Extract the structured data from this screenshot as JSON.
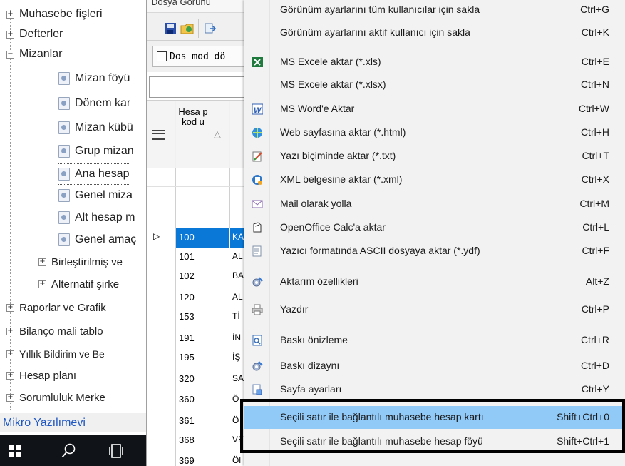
{
  "tree": {
    "items": [
      {
        "label": "Muhasebe fişleri",
        "expander": "+"
      },
      {
        "label": "Defterler",
        "expander": "+"
      },
      {
        "label": "Mizanlar",
        "expander": "−"
      },
      {
        "label": "Mizan föyü"
      },
      {
        "label": "Dönem kar"
      },
      {
        "label": "Mizan kübü"
      },
      {
        "label": "Grup mizan"
      },
      {
        "label": "Ana hesap"
      },
      {
        "label": "Genel miza"
      },
      {
        "label": "Alt hesap m"
      },
      {
        "label": "Genel amaç"
      },
      {
        "label": "Birleştirilmiş ve",
        "expander": "+"
      },
      {
        "label": "Alternatif şirke",
        "expander": "+"
      },
      {
        "label": "Raporlar ve Grafik",
        "expander": "+"
      },
      {
        "label": "Bilanço mali tablo",
        "expander": "+"
      },
      {
        "label": "Yıllık Bildirim ve Be",
        "expander": "+"
      },
      {
        "label": "Hesap planı",
        "expander": "+"
      },
      {
        "label": "Sorumluluk Merke",
        "expander": "+"
      }
    ],
    "footer_link": "Mikro Yazılımevi"
  },
  "grid": {
    "menubar": "Dosya  Görünü",
    "checkbox_label": "Dos mod dö",
    "column_header": "Hesa p kod u",
    "sort_glyph": "△",
    "current_row_marker": "▷",
    "rows": [
      {
        "code": "100",
        "name": "KA"
      },
      {
        "code": "101",
        "name": "AL"
      },
      {
        "code": "102",
        "name": "BA"
      },
      {
        "code": "120",
        "name": "AL"
      },
      {
        "code": "153",
        "name": "Tİ"
      },
      {
        "code": "191",
        "name": "İN"
      },
      {
        "code": "195",
        "name": "İŞ"
      },
      {
        "code": "320",
        "name": "SA"
      },
      {
        "code": "360",
        "name": "Ö"
      },
      {
        "code": "361",
        "name": "Ö"
      },
      {
        "code": "368",
        "name": "VE"
      },
      {
        "code": "369",
        "name": "Öl"
      }
    ]
  },
  "menu": {
    "items": [
      {
        "label": "Görünüm ayarlarını tüm kullanıcılar için sakla",
        "shortcut": "Ctrl+G",
        "icon": ""
      },
      {
        "label": "Görünüm ayarlarını aktif kullanıcı için sakla",
        "shortcut": "Ctrl+K",
        "icon": ""
      },
      {
        "label": "MS Excele aktar (*.xls)",
        "shortcut": "Ctrl+E",
        "icon": "excel-icon"
      },
      {
        "label": "MS Excele aktar (*.xlsx)",
        "shortcut": "Ctrl+N",
        "icon": ""
      },
      {
        "label": "MS Word'e Aktar",
        "shortcut": "Ctrl+W",
        "icon": "word-icon"
      },
      {
        "label": "Web sayfasına aktar (*.html)",
        "shortcut": "Ctrl+H",
        "icon": "web-icon"
      },
      {
        "label": "Yazı biçiminde aktar (*.txt)",
        "shortcut": "Ctrl+T",
        "icon": "text-edit-icon"
      },
      {
        "label": "XML belgesine aktar (*.xml)",
        "shortcut": "Ctrl+X",
        "icon": "xml-icon"
      },
      {
        "label": "Mail olarak yolla",
        "shortcut": "Ctrl+M",
        "icon": "mail-icon"
      },
      {
        "label": "OpenOffice Calc'a aktar",
        "shortcut": "Ctrl+L",
        "icon": "openoffice-icon"
      },
      {
        "label": "Yazıcı formatında ASCII dosyaya aktar (*.ydf)",
        "shortcut": "Ctrl+F",
        "icon": "ascii-file-icon"
      },
      {
        "label": "Aktarım özellikleri",
        "shortcut": "Alt+Z",
        "icon": "settings-gear-icon"
      },
      {
        "label": "Yazdır",
        "shortcut": "Ctrl+P",
        "icon": "printer-icon"
      },
      {
        "label": "Baskı önizleme",
        "shortcut": "Ctrl+R",
        "icon": "print-preview-icon"
      },
      {
        "label": "Baskı dizaynı",
        "shortcut": "Ctrl+D",
        "icon": "print-design-icon"
      },
      {
        "label": "Sayfa ayarları",
        "shortcut": "Ctrl+Y",
        "icon": "page-setup-icon"
      },
      {
        "label": "Seçili satır ile bağlantılı muhasebe hesap kartı",
        "shortcut": "Shift+Ctrl+0",
        "icon": ""
      },
      {
        "label": "Seçili satır ile bağlantılı muhasebe hesap föyü",
        "shortcut": "Shift+Ctrl+1",
        "icon": ""
      }
    ],
    "highlighted_index": 16,
    "colors": {
      "highlight": "#91c9f7",
      "menu_bg": "#f2f2f2",
      "selection_blue": "#0a78d7"
    }
  }
}
